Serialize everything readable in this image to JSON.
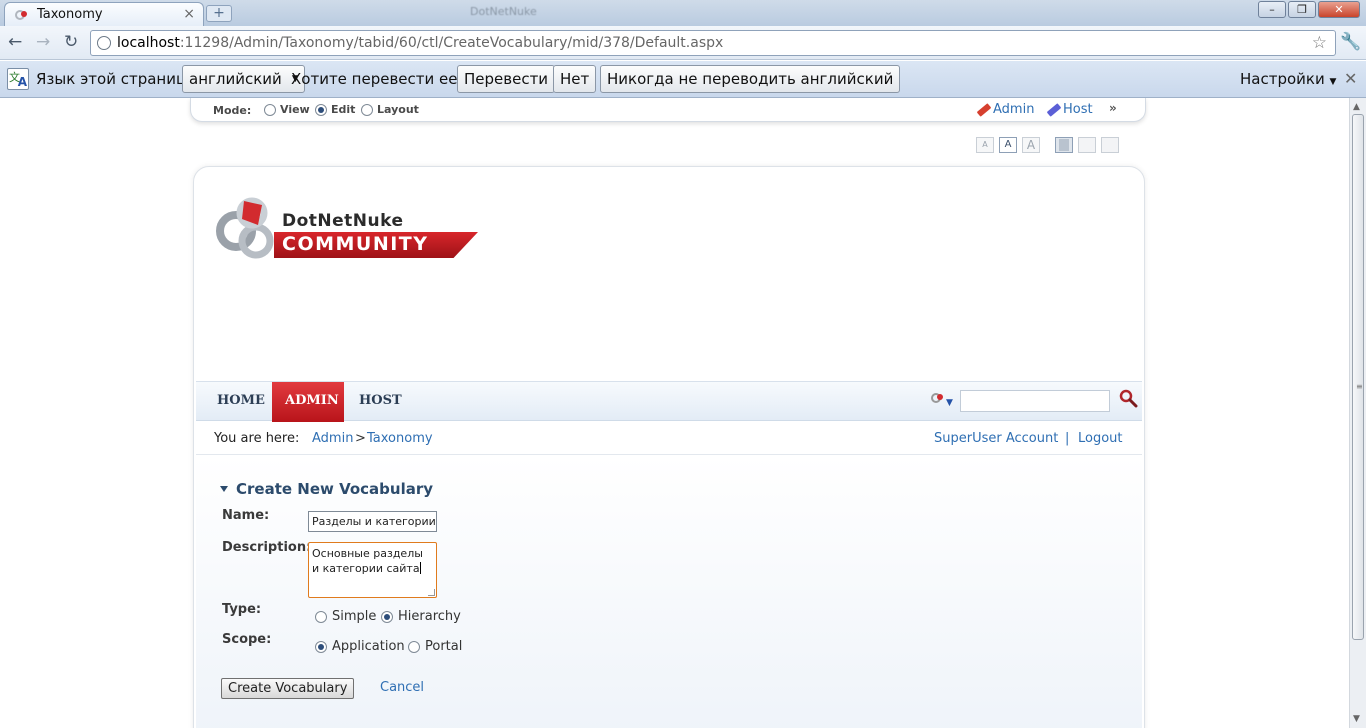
{
  "browser": {
    "tab_title": "Taxonomy",
    "window_title": "DotNetNuke",
    "url_host": "localhost",
    "url_rest": ":11298/Admin/Taxonomy/tabid/60/ctl/CreateVocabulary/mid/378/Default.aspx"
  },
  "translate_bar": {
    "lang_label": "Язык этой страницы",
    "lang_value": "английский",
    "question": "Хотите перевести ее?",
    "translate_button": "Перевести",
    "no_button": "Нет",
    "never_button": "Никогда не переводить английский",
    "settings": "Настройки"
  },
  "control_bar": {
    "mode_label": "Mode:",
    "modes": [
      "View",
      "Edit",
      "Layout"
    ],
    "selected_mode": "Edit",
    "admin_link": "Admin",
    "host_link": "Host"
  },
  "logo": {
    "line1": "DotNetNuke",
    "line2": "COMMUNITY"
  },
  "menu": [
    {
      "label": "HOME",
      "active": false
    },
    {
      "label": "ADMIN",
      "active": true
    },
    {
      "label": "HOST",
      "active": false
    }
  ],
  "breadcrumb": {
    "label": "You are here:",
    "items": [
      "Admin",
      "Taxonomy"
    ],
    "separator": ">",
    "user_link": "SuperUser Account",
    "divider": "|",
    "logout": "Logout"
  },
  "form": {
    "section_title": "Create New Vocabulary",
    "name_label": "Name:",
    "name_value": "Разделы и категории",
    "description_label": "Description:",
    "description_value": "Основные разделы и категории сайта",
    "type_label": "Type:",
    "type_options": [
      "Simple",
      "Hierarchy"
    ],
    "type_selected": "Hierarchy",
    "scope_label": "Scope:",
    "scope_options": [
      "Application",
      "Portal"
    ],
    "scope_selected": "Application",
    "create_button": "Create Vocabulary",
    "cancel_link": "Cancel"
  },
  "colors": {
    "accent_red": "#c8181e",
    "link_blue": "#2f6fb3",
    "title_blue": "#2c4b6c"
  }
}
